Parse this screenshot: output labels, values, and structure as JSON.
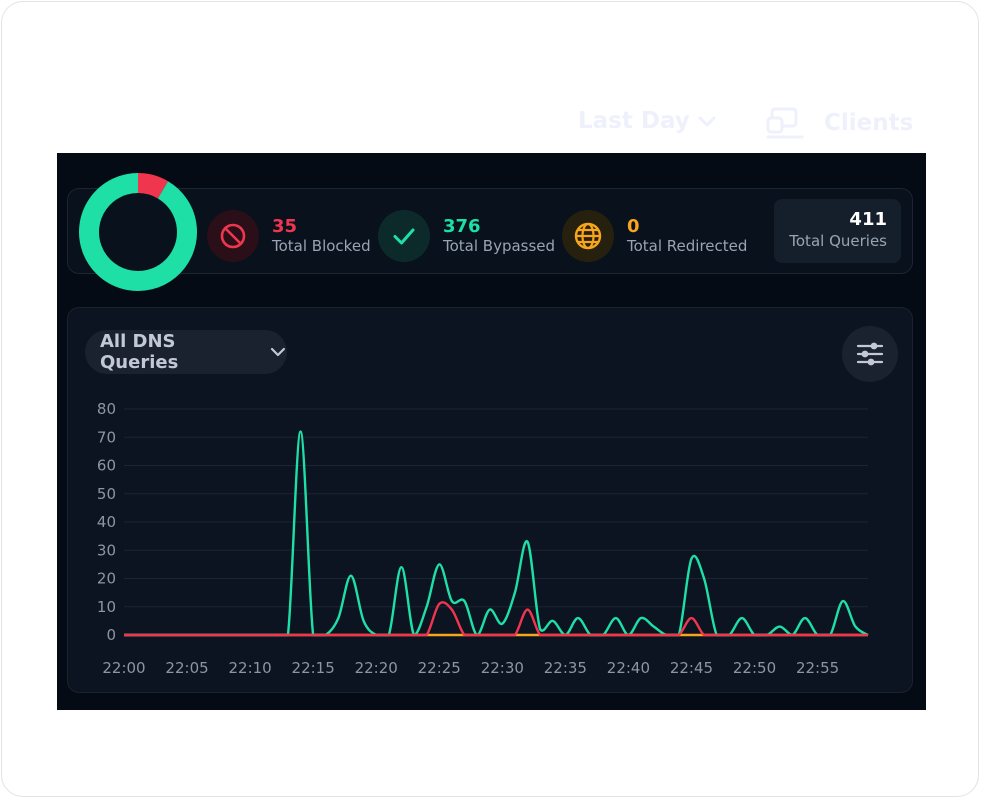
{
  "header": {
    "range_label": "Last Day",
    "clients_label": "Clients"
  },
  "stats": {
    "blocked": {
      "value": "35",
      "label": "Total Blocked",
      "color": "#f0364f"
    },
    "bypassed": {
      "value": "376",
      "label": "Total Bypassed",
      "color": "#1ee0a6"
    },
    "redirected": {
      "value": "0",
      "label": "Total Redirected",
      "color": "#f7a51c"
    },
    "total": {
      "value": "411",
      "label": "Total Queries"
    }
  },
  "donut": {
    "blocked": 35,
    "bypassed": 376,
    "redirected": 0
  },
  "filter": {
    "label": "All DNS Queries"
  },
  "icons": {
    "blocked": "ban-icon",
    "bypassed": "check-icon",
    "redirected": "globe-icon",
    "settings": "sliders-icon",
    "dropdown": "chevron-down-icon",
    "clients": "clients-icon"
  },
  "chart_data": {
    "type": "line",
    "title": "",
    "xlabel": "",
    "ylabel": "",
    "ylim": [
      0,
      80
    ],
    "y_ticks": [
      0,
      10,
      20,
      30,
      40,
      50,
      60,
      70,
      80
    ],
    "x_ticks": [
      "22:00",
      "22:05",
      "22:10",
      "22:15",
      "22:20",
      "22:25",
      "22:30",
      "22:35",
      "22:40",
      "22:45",
      "22:50",
      "22:55"
    ],
    "x": [
      "22:00",
      "22:01",
      "22:02",
      "22:03",
      "22:04",
      "22:05",
      "22:06",
      "22:07",
      "22:08",
      "22:09",
      "22:10",
      "22:11",
      "22:12",
      "22:13",
      "22:14",
      "22:15",
      "22:16",
      "22:17",
      "22:18",
      "22:19",
      "22:20",
      "22:21",
      "22:22",
      "22:23",
      "22:24",
      "22:25",
      "22:26",
      "22:27",
      "22:28",
      "22:29",
      "22:30",
      "22:31",
      "22:32",
      "22:33",
      "22:34",
      "22:35",
      "22:36",
      "22:37",
      "22:38",
      "22:39",
      "22:40",
      "22:41",
      "22:42",
      "22:43",
      "22:44",
      "22:45",
      "22:46",
      "22:47",
      "22:48",
      "22:49",
      "22:50",
      "22:51",
      "22:52",
      "22:53",
      "22:54",
      "22:55",
      "22:56",
      "22:57",
      "22:58",
      "22:59"
    ],
    "series": [
      {
        "color": "#1ee0a6",
        "values": [
          0,
          0,
          0,
          0,
          0,
          0,
          0,
          0,
          0,
          0,
          0,
          0,
          0,
          0,
          72,
          0,
          0,
          6,
          21,
          5,
          0,
          0,
          24,
          0,
          10,
          25,
          12,
          12,
          0,
          9,
          4,
          15,
          33,
          2,
          5,
          0,
          6,
          0,
          0,
          6,
          0,
          6,
          3,
          0,
          0,
          27,
          20,
          0,
          0,
          6,
          0,
          0,
          3,
          0,
          6,
          0,
          0,
          12,
          3,
          0
        ]
      },
      {
        "color": "#f0364f",
        "values": [
          0,
          0,
          0,
          0,
          0,
          0,
          0,
          0,
          0,
          0,
          0,
          0,
          0,
          0,
          0,
          0,
          0,
          0,
          0,
          0,
          0,
          0,
          0,
          0,
          0,
          11,
          9,
          0,
          0,
          0,
          0,
          0,
          9,
          0,
          0,
          0,
          0,
          0,
          0,
          0,
          0,
          0,
          0,
          0,
          0,
          6,
          0,
          0,
          0,
          0,
          0,
          0,
          0,
          0,
          0,
          0,
          0,
          0,
          0,
          0
        ]
      },
      {
        "color": "#f7a51c",
        "values": [
          0,
          0,
          0,
          0,
          0,
          0,
          0,
          0,
          0,
          0,
          0,
          0,
          0,
          0,
          0,
          0,
          0,
          0,
          0,
          0,
          0,
          0,
          0,
          0,
          0,
          0,
          0,
          0,
          0,
          0,
          0,
          0,
          0,
          0,
          0,
          0,
          0,
          0,
          0,
          0,
          0,
          0,
          0,
          0,
          0,
          0,
          0,
          0,
          0,
          0,
          0,
          0,
          0,
          0,
          0,
          0,
          0,
          0,
          0,
          0
        ]
      }
    ],
    "grid": true
  }
}
